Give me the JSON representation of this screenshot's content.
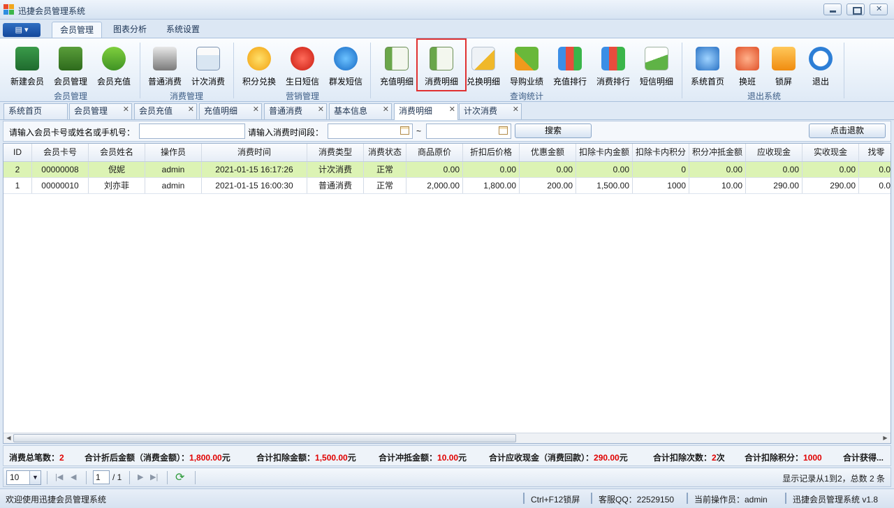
{
  "window": {
    "title": "迅捷会员管理系统"
  },
  "ribbon_tabs": [
    "会员管理",
    "图表分析",
    "系统设置"
  ],
  "ribbon_groups": [
    {
      "label": "会员管理",
      "buttons": [
        "新建会员",
        "会员管理",
        "会员充值"
      ]
    },
    {
      "label": "消费管理",
      "buttons": [
        "普通消费",
        "计次消费"
      ]
    },
    {
      "label": "营销管理",
      "buttons": [
        "积分兑换",
        "生日短信",
        "群发短信"
      ]
    },
    {
      "label": "查询统计",
      "buttons": [
        "充值明细",
        "消费明细",
        "兑换明细",
        "导购业绩",
        "充值排行",
        "消费排行",
        "短信明细"
      ]
    },
    {
      "label": "退出系统",
      "buttons": [
        "系统首页",
        "换班",
        "锁屏",
        "退出"
      ]
    }
  ],
  "doc_tabs": [
    "系统首页",
    "会员管理",
    "会员充值",
    "充值明细",
    "普通消费",
    "基本信息",
    "消费明细",
    "计次消费"
  ],
  "search": {
    "label_member": "请输入会员卡号或姓名或手机号：",
    "label_time": "请输入消费时间段：",
    "tilde": "~",
    "search_button": "搜索",
    "refund_button": "点击退款"
  },
  "table": {
    "columns": [
      "ID",
      "会员卡号",
      "会员姓名",
      "操作员",
      "消费时间",
      "消费类型",
      "消费状态",
      "商品原价",
      "折扣后价格",
      "优惠金额",
      "扣除卡内金额",
      "扣除卡内积分",
      "积分冲抵金额",
      "应收现金",
      "实收现金",
      "找零"
    ],
    "rows": [
      [
        "2",
        "00000008",
        "倪妮",
        "admin",
        "2021-01-15 16:17:26",
        "计次消费",
        "正常",
        "0.00",
        "0.00",
        "0.00",
        "0.00",
        "0",
        "0.00",
        "0.00",
        "0.00",
        "0.0"
      ],
      [
        "1",
        "00000010",
        "刘亦菲",
        "admin",
        "2021-01-15 16:00:30",
        "普通消费",
        "正常",
        "2,000.00",
        "1,800.00",
        "200.00",
        "1,500.00",
        "1000",
        "10.00",
        "290.00",
        "290.00",
        "0.0"
      ]
    ]
  },
  "summary": {
    "count_label": "消费总笔数：",
    "count": "2",
    "discount_label": "合计折后金额（消费金额）：",
    "discount": "1,800.00",
    "discount_unit": "元",
    "deduct_label": "合计扣除金额：",
    "deduct": "1,500.00",
    "deduct_unit": "元",
    "points_amount_label": "合计冲抵金额：",
    "points_amount": "10.00",
    "points_amount_unit": "元",
    "cash_label": "合计应收现金（消费回款）：",
    "cash": "290.00",
    "cash_unit": "元",
    "times_label": "合计扣除次数：",
    "times": "2",
    "times_unit": "次",
    "points_label": "合计扣除积分：",
    "points": "1000",
    "earned_label": "合计获得..."
  },
  "pager": {
    "page_size": "10",
    "page": "1",
    "total_pages": "/ 1",
    "info": "显示记录从1到2，总数 2 条"
  },
  "status": {
    "welcome": "欢迎使用迅捷会员管理系统",
    "lock": "Ctrl+F12锁屏",
    "qq": "客服QQ：22529150",
    "operator": "当前操作员：admin",
    "version": "迅捷会员管理系统 v1.8"
  },
  "colors": {
    "accent": "#e00000",
    "selected_row": "#dcf3b4",
    "highlight_box": "#e03131"
  }
}
